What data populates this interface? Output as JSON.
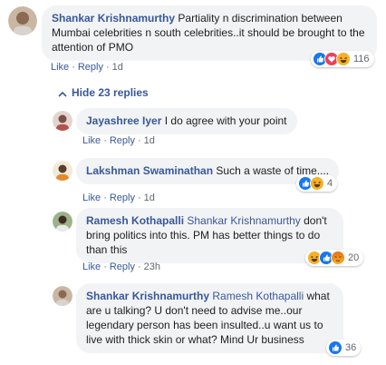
{
  "comments": [
    {
      "author": "Shankar Krishnamurthy",
      "text": "Partiality n discrimination between Mumbai celebrities n south celebrities..it should be brought to the attention of PMO",
      "like": "Like",
      "reply": "Reply",
      "time": "1d",
      "reaction_count": "116",
      "reactions": [
        "like-icon",
        "love-icon",
        "haha-icon"
      ]
    },
    {
      "author": "Jayashree Iyer",
      "text": "I do agree with your point",
      "like": "Like",
      "reply": "Reply",
      "time": "1d"
    },
    {
      "author": "Lakshman Swaminathan",
      "text": "Such a waste of time....",
      "like": "Like",
      "reply": "Reply",
      "time": "1d",
      "reaction_count": "4",
      "reactions": [
        "like-icon",
        "haha-icon"
      ]
    },
    {
      "author": "Ramesh Kothapalli",
      "mention": "Shankar Krishnamurthy",
      "text": "don't bring politics into this. PM has better things to do than this",
      "like": "Like",
      "reply": "Reply",
      "time": "23h",
      "reaction_count": "20",
      "reactions": [
        "haha-icon",
        "like-icon",
        "angry-icon"
      ]
    },
    {
      "author": "Shankar Krishnamurthy",
      "mention": "Ramesh Kothapalli",
      "text": "what are u talking? U don't need to advise me..our legendary person has been insulted..u want us to live with thick skin or what? Mind Ur business",
      "like": "Like",
      "reply": "Reply",
      "time": "23h",
      "reaction_count": "36",
      "reactions": [
        "like-icon"
      ]
    }
  ],
  "hide_replies": "Hide 23 replies",
  "separator": "·",
  "colors": {
    "link": "#385898",
    "bubble": "#f2f3f5",
    "meta": "#606770"
  }
}
